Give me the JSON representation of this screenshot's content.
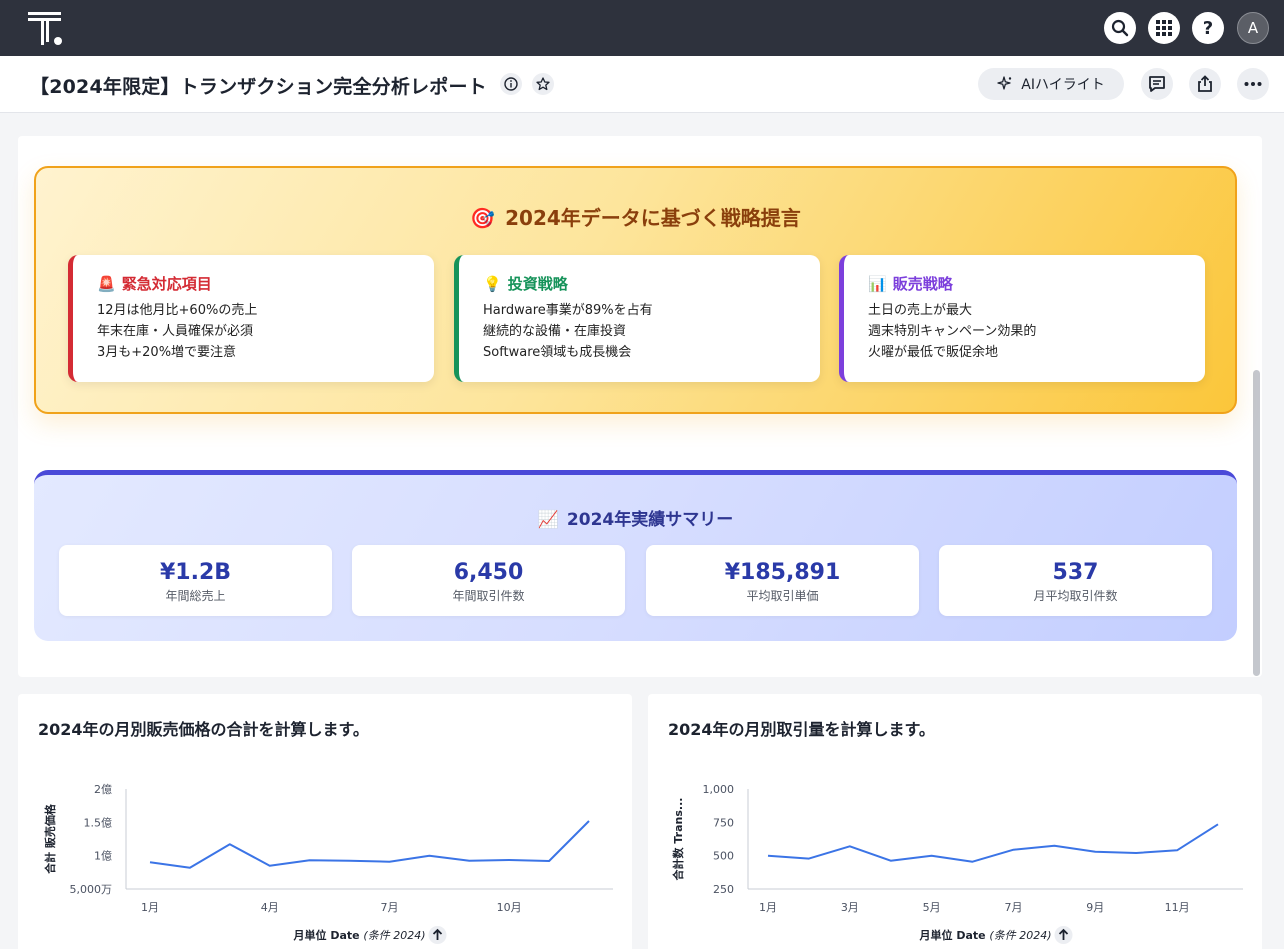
{
  "nav": {
    "avatar_letter": "A",
    "help": "?"
  },
  "header": {
    "title": "【2024年限定】トランザクション完全分析レポート",
    "ai_button": "AIハイライト"
  },
  "strategy": {
    "title": "2024年データに基づく戦略提言",
    "cards": [
      {
        "icon": "🚨",
        "heading": "緊急対応項目",
        "lines": [
          "12月は他月比+60%の売上",
          "年末在庫・人員確保が必須",
          "3月も+20%増で要注意"
        ],
        "color": "#d42b34"
      },
      {
        "icon": "💡",
        "heading": "投資戦略",
        "lines": [
          "Hardware事業が89%を占有",
          "継続的な設備・在庫投資",
          "Software領域も成長機会"
        ],
        "color": "#16935a"
      },
      {
        "icon": "📊",
        "heading": "販売戦略",
        "lines": [
          "土日の売上が最大",
          "週末特別キャンペーン効果的",
          "火曜が最低で販促余地"
        ],
        "color": "#7c3fdc"
      }
    ]
  },
  "summary": {
    "title": "2024年実績サマリー",
    "kpis": [
      {
        "value": "¥1.2B",
        "label": "年間総売上"
      },
      {
        "value": "6,450",
        "label": "年間取引件数"
      },
      {
        "value": "¥185,891",
        "label": "平均取引単価"
      },
      {
        "value": "537",
        "label": "月平均取引件数"
      }
    ]
  },
  "chart_data": [
    {
      "type": "line",
      "title": "2024年の月別販売価格の合計を計算します。",
      "ylabel": "合計 販売価格",
      "xlabel": "月単位 Date",
      "xlabel_note": "(条件 2024)",
      "x": [
        "1月",
        "2月",
        "3月",
        "4月",
        "5月",
        "6月",
        "7月",
        "8月",
        "9月",
        "10月",
        "11月",
        "12月"
      ],
      "x_tick_labels": [
        "1月",
        "4月",
        "7月",
        "10月"
      ],
      "y_tick_labels": [
        "2億",
        "1.5億",
        "1億",
        "5,000万"
      ],
      "y_tick_values": [
        200000000,
        150000000,
        100000000,
        50000000
      ],
      "ylim": [
        50000000,
        200000000
      ],
      "values": [
        90000000,
        82000000,
        117000000,
        85000000,
        93000000,
        92500000,
        91000000,
        100000000,
        92500000,
        93500000,
        92000000,
        152000000
      ],
      "color": "#3b74e6"
    },
    {
      "type": "line",
      "title": "2024年の月別取引量を計算します。",
      "ylabel": "合計数 Trans...",
      "xlabel": "月単位 Date",
      "xlabel_note": "(条件 2024)",
      "x": [
        "1月",
        "2月",
        "3月",
        "4月",
        "5月",
        "6月",
        "7月",
        "8月",
        "9月",
        "10月",
        "11月",
        "12月"
      ],
      "x_tick_labels": [
        "1月",
        "3月",
        "5月",
        "7月",
        "9月",
        "11月"
      ],
      "y_tick_labels": [
        "1,000",
        "750",
        "500",
        "250"
      ],
      "y_tick_values": [
        1000,
        750,
        500,
        250
      ],
      "ylim": [
        250,
        1000
      ],
      "values": [
        500,
        478,
        570,
        462,
        500,
        455,
        545,
        575,
        530,
        520,
        540,
        735
      ],
      "color": "#3b74e6"
    }
  ]
}
